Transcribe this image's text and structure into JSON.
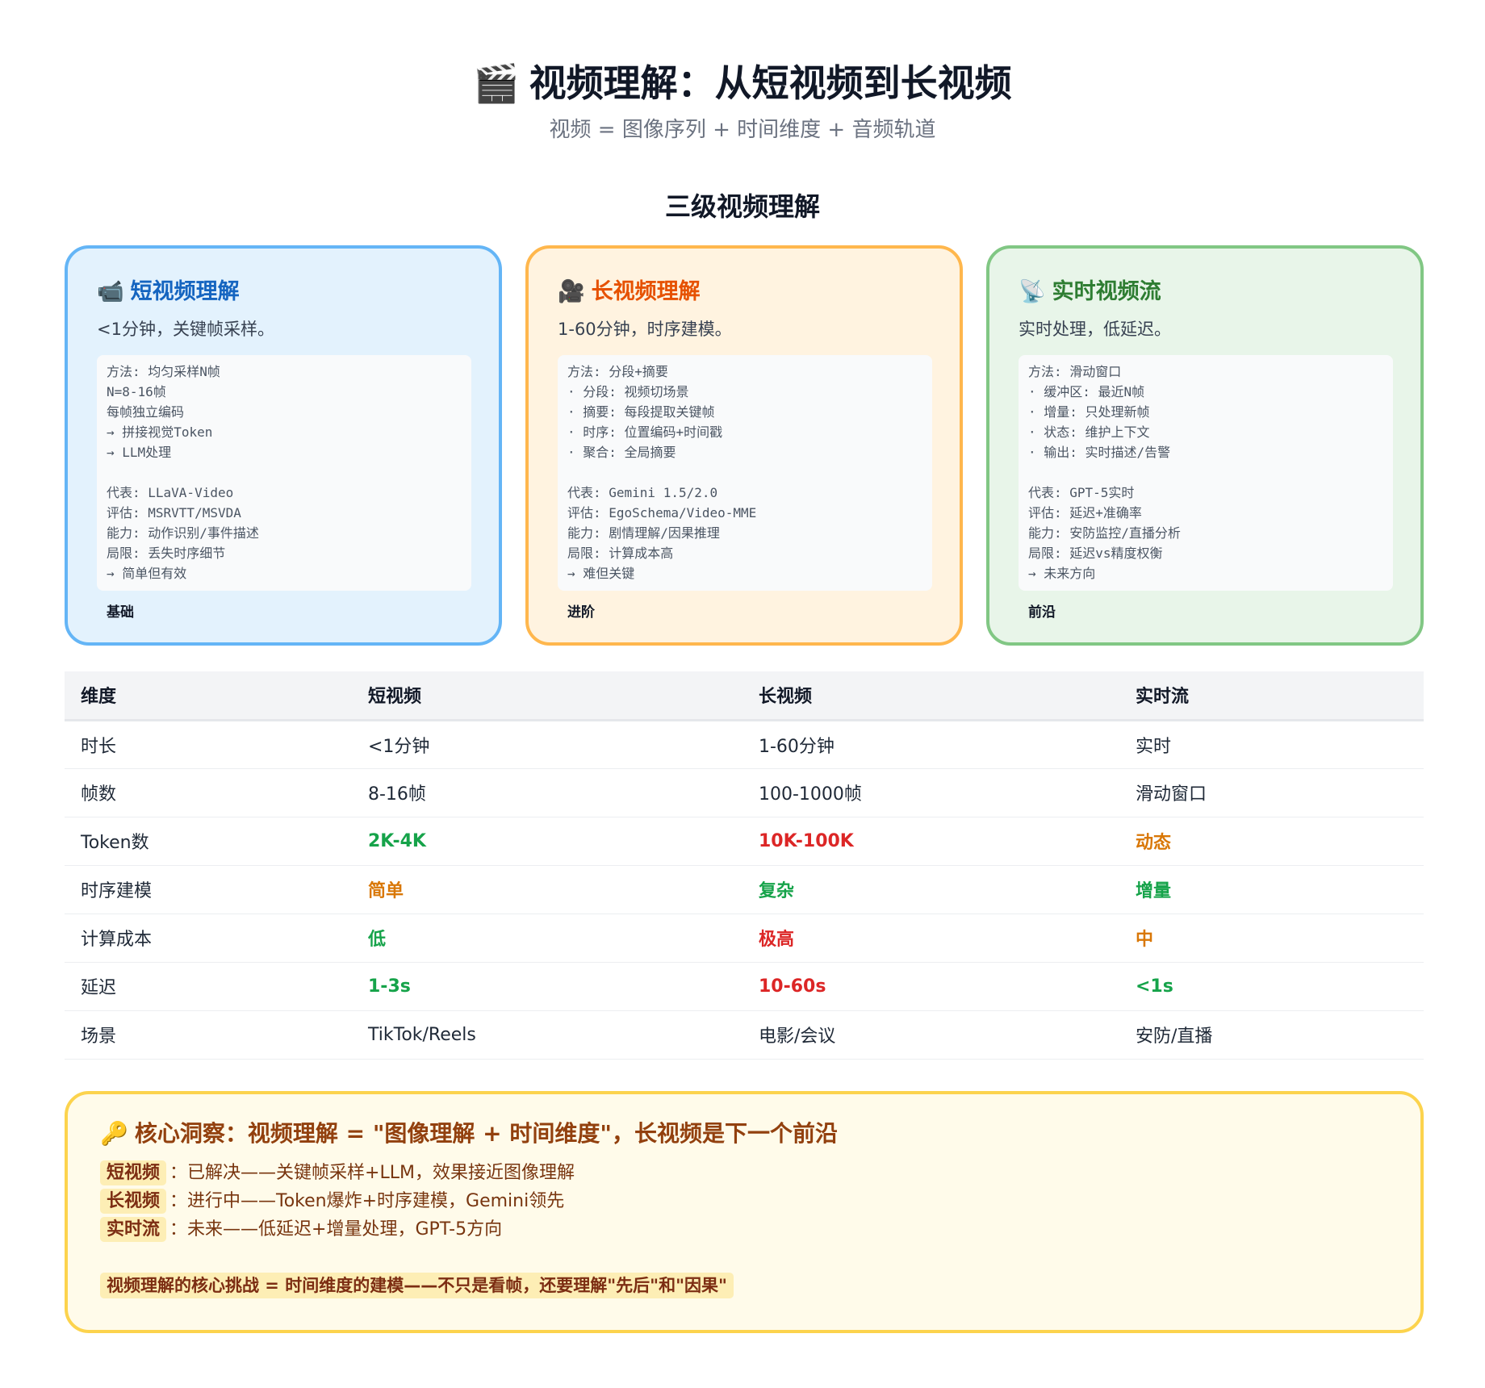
{
  "header": {
    "title_emoji": "🎬",
    "title": "视频理解：从短视频到长视频",
    "subtitle": "视频 = 图像序列 + 时间维度 + 音频轨道"
  },
  "section": {
    "title": "三级视频理解"
  },
  "cards": [
    {
      "emoji": "📹",
      "title": "短视频理解",
      "desc": "<1分钟，关键帧采样。",
      "lines": [
        "方法: 均匀采样N帧",
        "N=8-16帧",
        "每帧独立编码",
        "→ 拼接视觉Token",
        "→ LLM处理",
        "",
        "代表: LLaVA-Video",
        "评估: MSRVTT/MSVDA",
        "能力: 动作识别/事件描述",
        "局限: 丢失时序细节",
        "→ 简单但有效"
      ],
      "level": "基础",
      "color": "#1565c0"
    },
    {
      "emoji": "🎥",
      "title": "长视频理解",
      "desc": "1-60分钟，时序建模。",
      "lines": [
        "方法: 分段+摘要",
        "· 分段: 视频切场景",
        "· 摘要: 每段提取关键帧",
        "· 时序: 位置编码+时间戳",
        "· 聚合: 全局摘要",
        "",
        "代表: Gemini 1.5/2.0",
        "评估: EgoSchema/Video-MME",
        "能力: 剧情理解/因果推理",
        "局限: 计算成本高",
        "→ 难但关键"
      ],
      "level": "进阶",
      "color": "#e65100"
    },
    {
      "emoji": "📡",
      "title": "实时视频流",
      "desc": "实时处理，低延迟。",
      "lines": [
        "方法: 滑动窗口",
        "· 缓冲区: 最近N帧",
        "· 增量: 只处理新帧",
        "· 状态: 维护上下文",
        "· 输出: 实时描述/告警",
        "",
        "代表: GPT-5实时",
        "评估: 延迟+准确率",
        "能力: 安防监控/直播分析",
        "局限: 延迟vs精度权衡",
        "→ 未来方向"
      ],
      "level": "前沿",
      "color": "#2e7d32"
    }
  ],
  "table": {
    "headers": [
      "维度",
      "短视频",
      "长视频",
      "实时流"
    ],
    "rows": [
      [
        "时长",
        "<1分钟",
        "1-60分钟",
        "实时"
      ],
      [
        "帧数",
        "8-16帧",
        "100-1000帧",
        "滑动窗口"
      ],
      [
        "Token数",
        "2K-4K",
        "10K-100K",
        "动态"
      ],
      [
        "时序建模",
        "简单",
        "复杂",
        "增量"
      ],
      [
        "计算成本",
        "低",
        "极高",
        "中"
      ],
      [
        "延迟",
        "1-3s",
        "10-60s",
        "<1s"
      ],
      [
        "场景",
        "TikTok/Reels",
        "电影/会议",
        "安防/直播"
      ]
    ],
    "highlight_colors": {
      "green": "#16a34a",
      "red": "#dc2626",
      "orange": "#d97706"
    }
  },
  "insight": {
    "emoji": "🔑",
    "title": "核心洞察：视频理解 = \"图像理解 + 时间维度\"，长视频是下一个前沿",
    "lines": [
      {
        "tag": "短视频",
        "text": "：已解决——关键帧采样+LLM，效果接近图像理解"
      },
      {
        "tag": "长视频",
        "text": "：进行中——Token爆炸+时序建模，Gemini领先"
      },
      {
        "tag": "实时流",
        "text": "：未来——低延迟+增量处理，GPT-5方向"
      }
    ],
    "final": "视频理解的核心挑战 = 时间维度的建模——不只是看帧，还要理解\"先后\"和\"因果\""
  }
}
